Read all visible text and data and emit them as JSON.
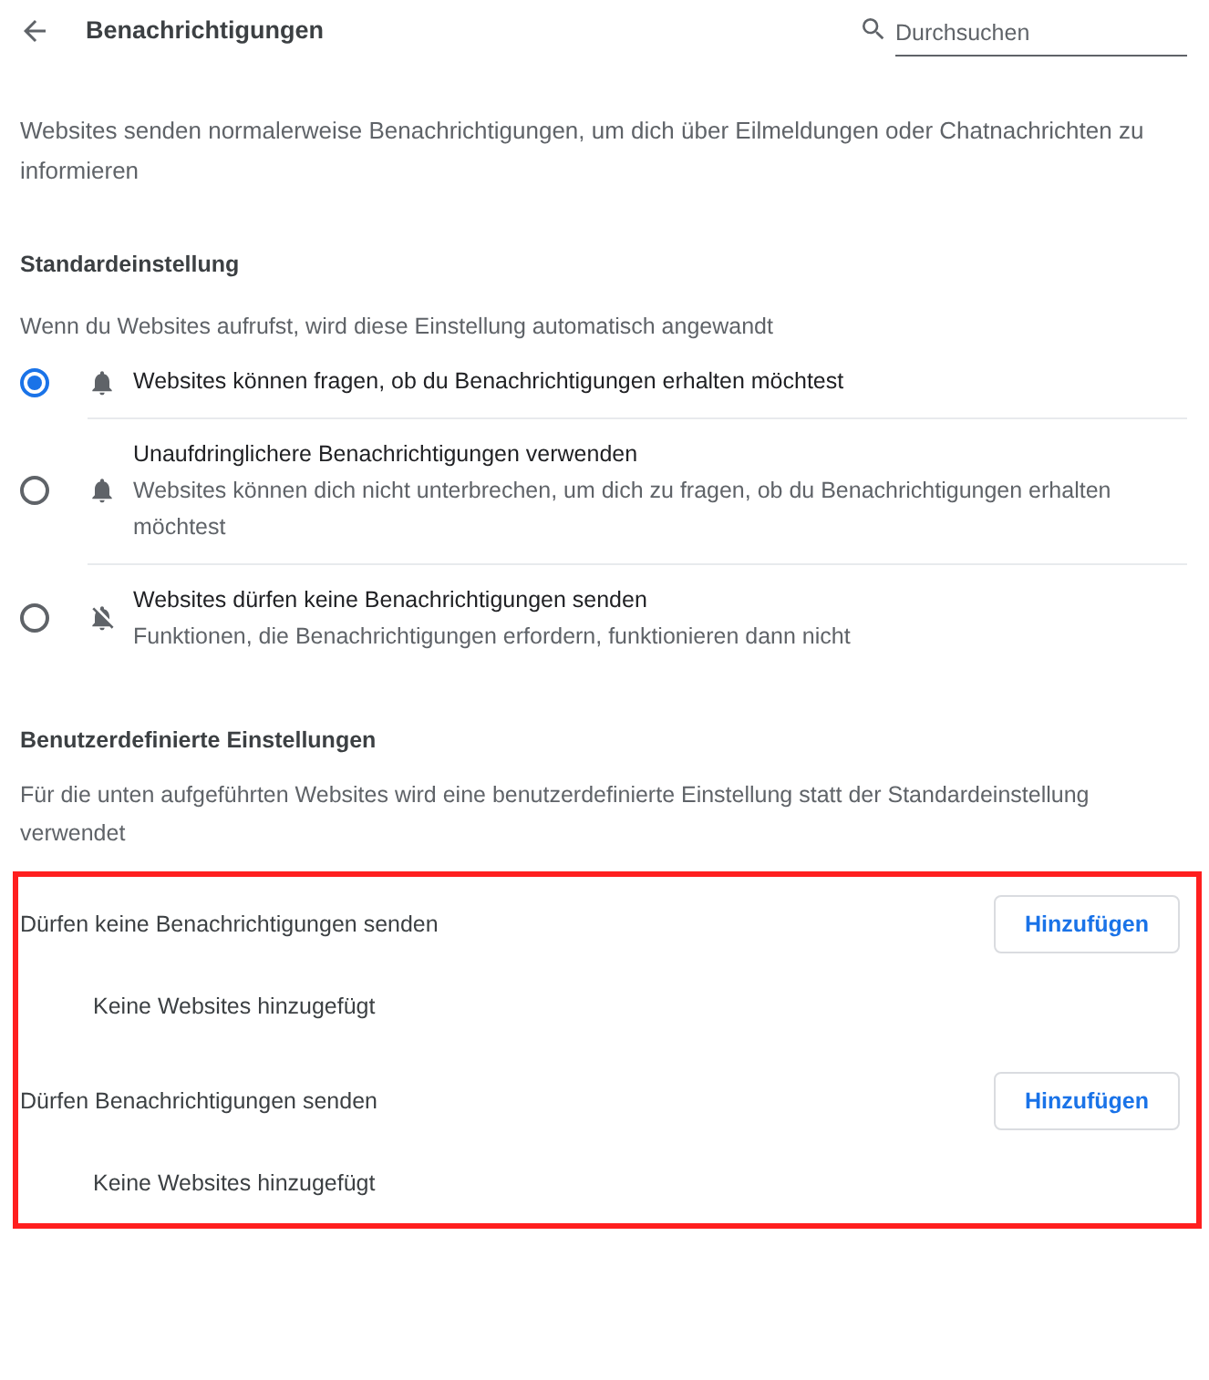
{
  "header": {
    "title": "Benachrichtigungen",
    "search": {
      "placeholder": "Durchsuchen"
    }
  },
  "intro": "Websites senden normalerweise Benachrichtigungen, um dich über Eilmeldungen oder Chatnachrichten zu informieren",
  "default_section": {
    "heading": "Standardeinstellung",
    "description": "Wenn du Websites aufrufst, wird diese Einstellung automatisch angewandt",
    "options": [
      {
        "kind": "bell",
        "label": "Websites können fragen, ob du Benachrichtigungen erhalten möchtest",
        "selected": true
      },
      {
        "kind": "bell",
        "label": "Unaufdringlichere Benachrichtigungen verwenden",
        "sublabel": "Websites können dich nicht unterbrechen, um dich zu fragen, ob du Benachrichtigungen erhalten möchtest",
        "selected": false
      },
      {
        "kind": "bell-off",
        "label": "Websites dürfen keine Benachrichtigungen senden",
        "sublabel": "Funktionen, die Benachrichtigungen erfordern, funktionieren dann nicht",
        "selected": false
      }
    ]
  },
  "custom_section": {
    "heading": "Benutzerdefinierte Einstellungen",
    "description": "Für die unten aufgeführten Websites wird eine benutzerdefinierte Einstellung statt der Standardeinstellung verwendet",
    "highlighted": true,
    "lists": [
      {
        "title": "Dürfen keine Benachrichtigungen senden",
        "button": "Hinzufügen",
        "empty_text": "Keine Websites hinzugefügt"
      },
      {
        "title": "Dürfen Benachrichtigungen senden",
        "button": "Hinzufügen",
        "empty_text": "Keine Websites hinzugefügt"
      }
    ]
  }
}
